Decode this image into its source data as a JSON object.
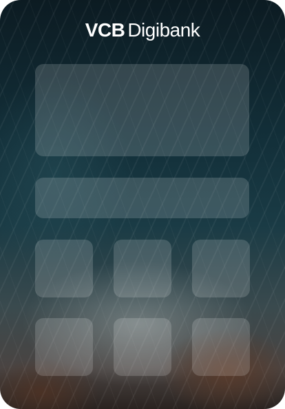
{
  "brand": {
    "vcb": "VCB",
    "digibank": "Digibank",
    "color": "#ffffff"
  },
  "placeholders": {
    "main_card": "",
    "info_bar": "",
    "tiles": [
      "",
      "",
      "",
      "",
      "",
      ""
    ]
  }
}
